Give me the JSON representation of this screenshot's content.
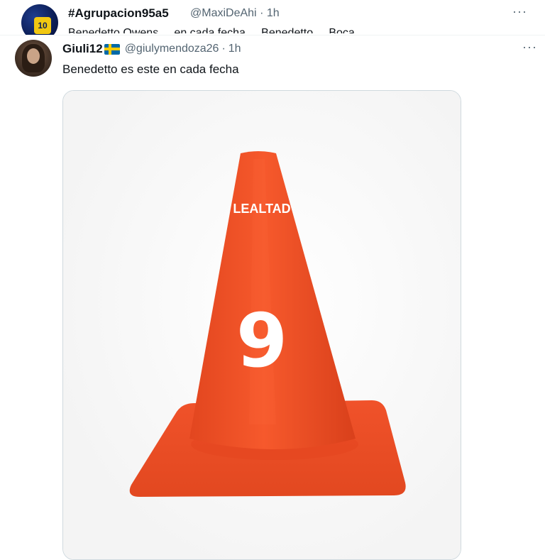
{
  "previous_tweet": {
    "display_name": "#Agrupacion95a5",
    "handle": "@MaxiDeAhi",
    "separator": "·",
    "time": "1h",
    "more": "···",
    "text_partial": "Benedetto Owens ... en cada fecha ... Benedetto ... Boca ...",
    "avatar_jersey_number": "10"
  },
  "tweet": {
    "display_name": "Giuli12",
    "flag_icon": "sweden-flag-icon",
    "handle": "@giulymendoza26",
    "separator": "·",
    "time": "1h",
    "more": "···",
    "text": "Benedetto es este en cada fecha",
    "media": {
      "cone_label": "LEALTAD",
      "cone_number": "9",
      "cone_color": "#f0522a"
    }
  }
}
